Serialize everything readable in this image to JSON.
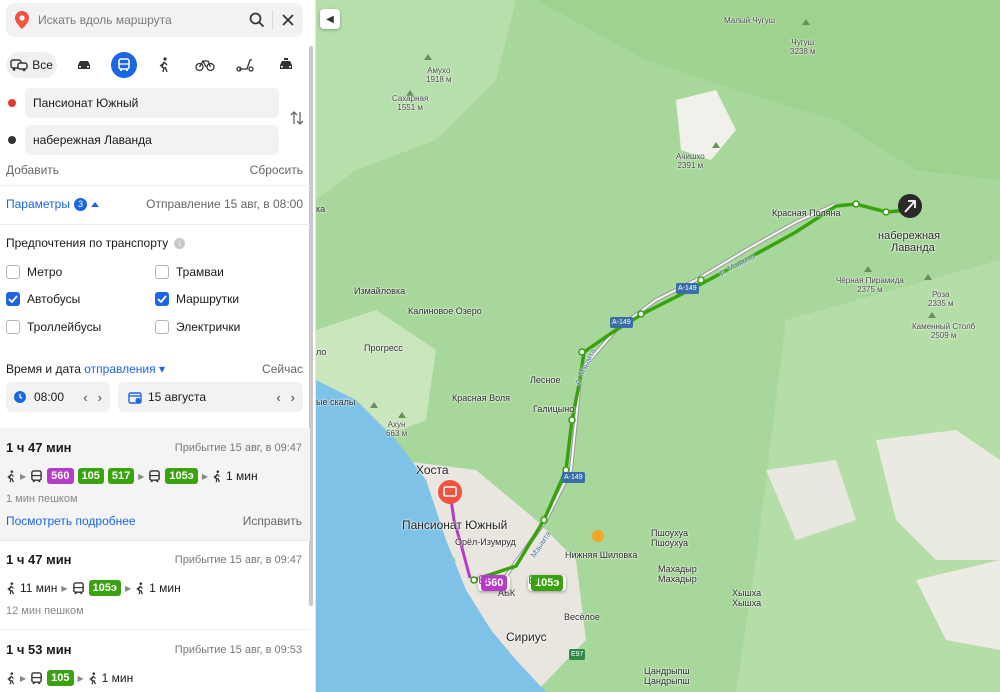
{
  "search": {
    "placeholder": "Искать вдоль маршрута"
  },
  "modes": {
    "all_label": "Все"
  },
  "points": {
    "from": "Пансионат Южный",
    "to": "набережная Лаванда"
  },
  "actions": {
    "add": "Добавить",
    "reset": "Сбросить"
  },
  "params": {
    "label": "Параметры",
    "count": "3",
    "departure": "Отправление 15 авг, в 08:00"
  },
  "prefs": {
    "title": "Предпочтения по транспорту",
    "items": [
      {
        "label": "Метро",
        "checked": false
      },
      {
        "label": "Трамваи",
        "checked": false
      },
      {
        "label": "Автобусы",
        "checked": true
      },
      {
        "label": "Маршрутки",
        "checked": true
      },
      {
        "label": "Троллейбусы",
        "checked": false
      },
      {
        "label": "Электрички",
        "checked": false
      }
    ]
  },
  "time": {
    "label": "Время и дата",
    "mode": "отправления",
    "now": "Сейчас",
    "time": "08:00",
    "date": "15 августа"
  },
  "routes": [
    {
      "duration": "1 ч 47 мин",
      "arrival": "Прибытие 15 авг, в 09:47",
      "chips": [
        "560",
        "105",
        "517"
      ],
      "chip2": "105э",
      "walk": "1 мин",
      "note": "1 мин пешком",
      "details": "Посмотреть подробнее",
      "fix": "Исправить"
    },
    {
      "duration": "1 ч 47 мин",
      "arrival": "Прибытие 15 авг, в 09:47",
      "walk_start": "11 мин",
      "chip": "105э",
      "walk": "1 мин",
      "note": "12 мин пешком"
    },
    {
      "duration": "1 ч 53 мин",
      "arrival": "Прибытие 15 авг, в 09:53",
      "chip": "105",
      "walk": "1 мин"
    }
  ],
  "map": {
    "towns": {
      "khosta": "Хоста",
      "pansionat": "Пансионат Южный",
      "lavanda1": "набережная",
      "lavanda2": "Лаванда",
      "krasnaya": "Красная Поляна",
      "izmaylovka": "Измайловка",
      "kalinovoe": "Калиновое Озеро",
      "progress": "Прогресс",
      "lesnoe": "Лесное",
      "krasvolya": "Красная Воля",
      "galitsyno": "Галицыно",
      "orel": "Орёл-Изумруд",
      "nizhnyaya": "Нижняя Шиловка",
      "pshoukha1": "Пшоухуа",
      "pshoukha2": "Пшоухуа",
      "makhador1": "Махадыр",
      "makhador2": "Махадыр",
      "khyshkha1": "Хышха",
      "khyshkha2": "Хышха",
      "veseloe": "Весёлое",
      "sirius": "Сириус",
      "tsandrypsh1": "Цандрыпш",
      "tsandrypsh2": "Цандрыпш",
      "adk": "АБК",
      "ka": "ка",
      "skaly": "ые скалы",
      "lo": "ло"
    },
    "peaks": {
      "malchugush": "Малый Чугуш",
      "chugush": "Чугуш\n3238 м",
      "amukho": "Амухо\n1918 м",
      "sakharnaya": "Сахарная\n1551 м",
      "achishkho": "Ачишхо\n2391 м",
      "chpiramida": "Чёрная Пирамида\n2375 м",
      "roza": "Роза\n2335 м",
      "kstolb": "Каменный Столб\n2509 м",
      "akhun": "Ахун\n663 м"
    },
    "roads": {
      "a149a": "А-149",
      "a149b": "А-149",
      "a149c": "А-149",
      "e97": "E97"
    },
    "rivers": {
      "mzymta": "р. Мзымта",
      "mzymta2": "р. Мзымта",
      "mzymta3": "Мзымта"
    },
    "stops": {
      "minibus": "560",
      "bus": "105э"
    }
  }
}
